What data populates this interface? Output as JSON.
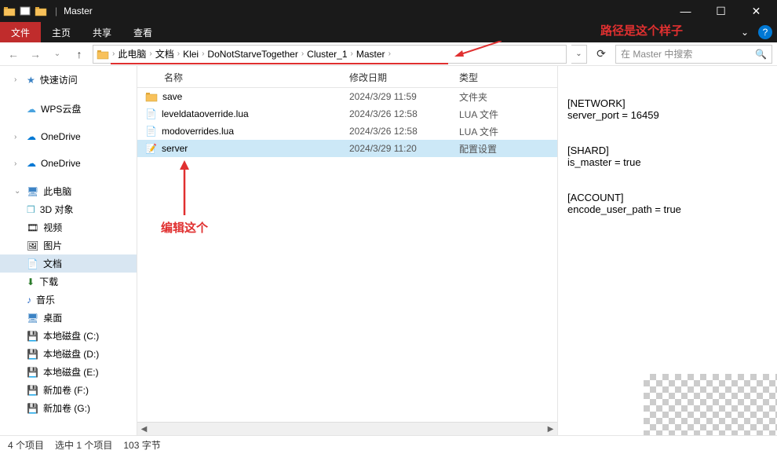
{
  "window": {
    "title": "Master",
    "minimize": "—",
    "maximize": "☐",
    "close": "✕"
  },
  "ribbon": {
    "file": "文件",
    "home": "主页",
    "share": "共享",
    "view": "查看"
  },
  "annotations": {
    "path_note": "路径是这个样子",
    "edit_note": "编辑这个"
  },
  "nav": {
    "back_tip": "后退",
    "forward_tip": "前进",
    "up_tip": "上一级"
  },
  "breadcrumb": {
    "items": [
      "此电脑",
      "文档",
      "Klei",
      "DoNotStarveTogether",
      "Cluster_1",
      "Master"
    ]
  },
  "search": {
    "placeholder": "在 Master 中搜索"
  },
  "sidebar": {
    "quick": "快速访问",
    "wps": "WPS云盘",
    "onedrive1": "OneDrive",
    "onedrive2": "OneDrive",
    "thispc": "此电脑",
    "items": [
      "3D 对象",
      "视频",
      "图片",
      "文档",
      "下载",
      "音乐",
      "桌面",
      "本地磁盘 (C:)",
      "本地磁盘 (D:)",
      "本地磁盘 (E:)",
      "新加卷 (F:)",
      "新加卷 (G:)"
    ]
  },
  "columns": {
    "name": "名称",
    "date": "修改日期",
    "type": "类型"
  },
  "files": [
    {
      "name": "save",
      "date": "2024/3/29 11:59",
      "type": "文件夹",
      "icon": "folder"
    },
    {
      "name": "leveldataoverride.lua",
      "date": "2024/3/26 12:58",
      "type": "LUA 文件",
      "icon": "file"
    },
    {
      "name": "modoverrides.lua",
      "date": "2024/3/26 12:58",
      "type": "LUA 文件",
      "icon": "file"
    },
    {
      "name": "server",
      "date": "2024/3/29 11:20",
      "type": "配置设置",
      "icon": "config"
    }
  ],
  "preview": {
    "content": "[NETWORK]\nserver_port = 16459\n\n\n[SHARD]\nis_master = true\n\n\n[ACCOUNT]\nencode_user_path = true"
  },
  "status": {
    "count": "4 个项目",
    "selection": "选中 1 个项目",
    "size": "103 字节"
  }
}
